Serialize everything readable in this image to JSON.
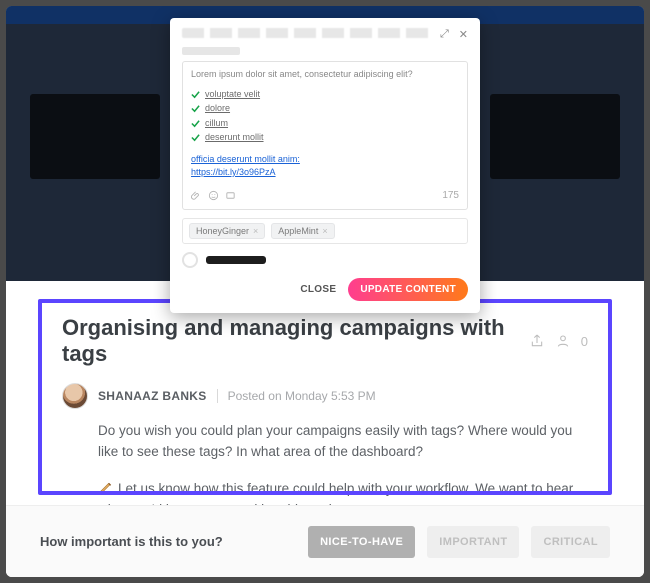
{
  "modal": {
    "lorem": "Lorem ipsum dolor sit amet, consectetur adipiscing elit?",
    "items": [
      "voluptate velit",
      "dolore",
      "cillum",
      "deserunt mollit"
    ],
    "link_line1": "officia deserunt mollit anim:",
    "link_line2": "https://bit.ly/3o96PzA",
    "counter": "175",
    "tags": [
      "HoneyGinger",
      "AppleMint"
    ],
    "close_label": "CLOSE",
    "update_label": "UPDATE CONTENT"
  },
  "post": {
    "title": "Organising and managing campaigns with tags",
    "comment_count": "0",
    "author": "SHANAAZ BANKS",
    "posted": "Posted on Monday 5:53 PM",
    "para1": "Do you wish you could plan your campaigns easily with tags? Where would you like to see these tags? In what area of the dashboard?",
    "para2": "Let us know how this feature could help with your workflow. We want to hear what you'd love to see and be able to do."
  },
  "footer": {
    "prompt": "How important is this to you?",
    "nice": "NICE-TO-HAVE",
    "important": "IMPORTANT",
    "critical": "CRITICAL"
  }
}
